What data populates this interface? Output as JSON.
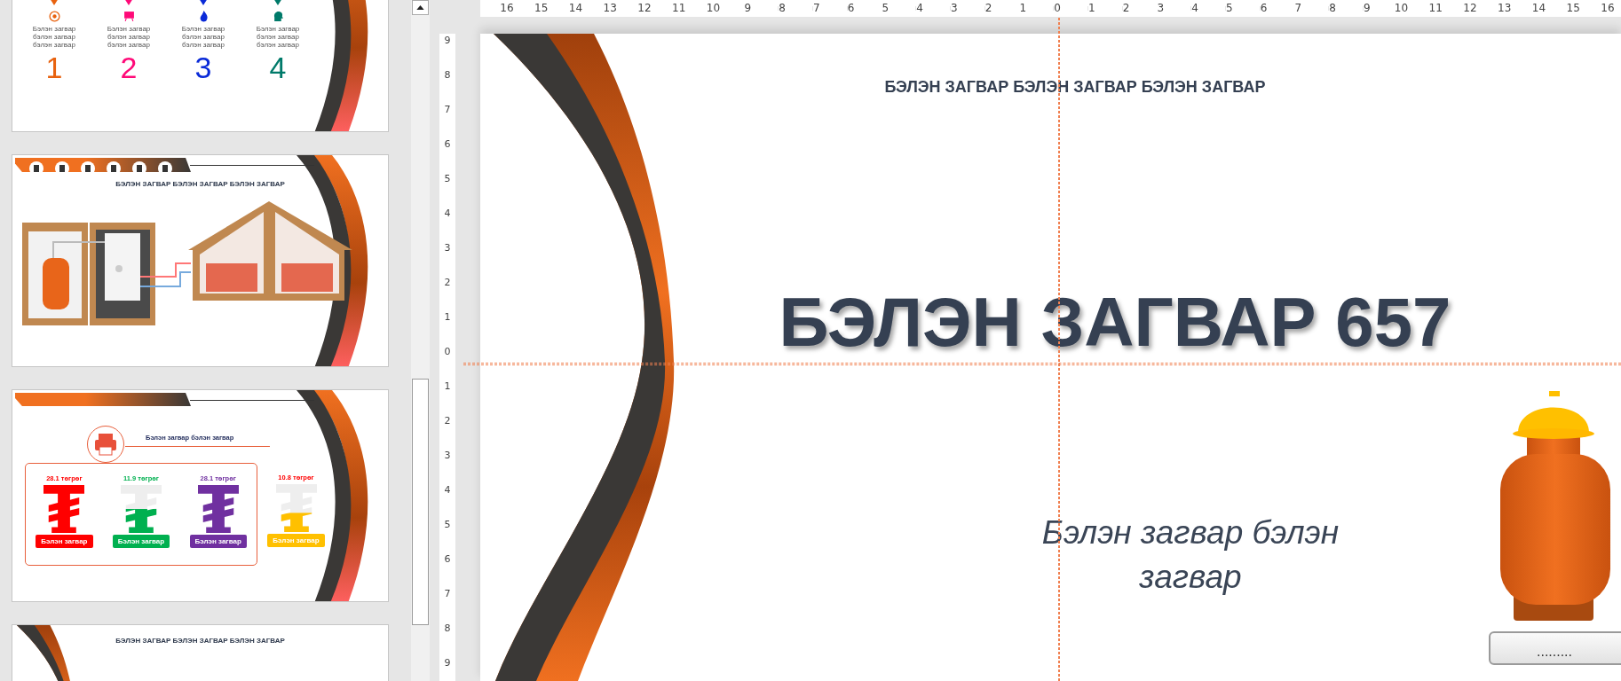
{
  "thumbnails": [
    {
      "kind": "steps",
      "steps": [
        {
          "lines": [
            "Бэлэн загвар",
            "бэлэн загвар",
            "бэлэн загвар"
          ],
          "number": "1",
          "color": "#e8620f"
        },
        {
          "lines": [
            "Бэлэн загвар",
            "бэлэн загвар",
            "бэлэн загвар"
          ],
          "number": "2",
          "color": "#ff0a78"
        },
        {
          "lines": [
            "Бэлэн загвар",
            "бэлэн загвар",
            "бэлэн загвар"
          ],
          "number": "3",
          "color": "#0a2ad8"
        },
        {
          "lines": [
            "Бэлэн загвар",
            "бэлэн загвар",
            "бэлэн загвар"
          ],
          "number": "4",
          "color": "#007a6a"
        }
      ]
    },
    {
      "kind": "diagram",
      "heading": "БЭЛЭН ЗАГВАР БЭЛЭН ЗАГВАР БЭЛЭН ЗАГВАР"
    },
    {
      "kind": "prices",
      "title": "Бэлэн загвар бэлэн загвар",
      "items": [
        {
          "value": {
            "text": "28.1 төгрөг",
            "color": "#ff0000"
          },
          "label": "Бэлэн загвар",
          "color": "#ff0000",
          "level": 1
        },
        {
          "value": {
            "text": "11.9 төгрөг",
            "color": "#00b050"
          },
          "label": "Бэлэн загвар",
          "color": "#00b050",
          "level": 0.5
        },
        {
          "value": {
            "text": "28.1 төгрөг",
            "color": "#7030a0"
          },
          "label": "Бэлэн загвар",
          "color": "#7030a0",
          "level": 1
        }
      ],
      "extra_items": [
        {
          "value": {
            "text": "10.8 төгрөг",
            "color": "#ff0000"
          },
          "label": "Бэлэн загвар",
          "color": "#ffc000",
          "level": 0.4
        }
      ]
    },
    {
      "kind": "title",
      "heading": "БЭЛЭН ЗАГВАР БЭЛЭН ЗАГВАР БЭЛЭН ЗАГВАР"
    }
  ],
  "ruler_horizontal": [
    "16",
    "15",
    "14",
    "13",
    "12",
    "11",
    "10",
    "9",
    "8",
    "7",
    "6",
    "5",
    "4",
    "3",
    "2",
    "1",
    "0",
    "1",
    "2",
    "3",
    "4",
    "5",
    "6",
    "7",
    "8",
    "9",
    "10",
    "11",
    "12",
    "13",
    "14",
    "15",
    "16"
  ],
  "ruler_vertical": [
    "9",
    "8",
    "7",
    "6",
    "5",
    "4",
    "3",
    "2",
    "1",
    "0",
    "1",
    "2",
    "3",
    "4",
    "5",
    "6",
    "7",
    "8",
    "9"
  ],
  "slide": {
    "heading": "БЭЛЭН ЗАГВАР БЭЛЭН ЗАГВАР БЭЛЭН ЗАГВАР",
    "title": "БЭЛЭН ЗАГВАР 657",
    "subtitle": "Бэлэн загвар бэлэн загвар",
    "badge": "........."
  }
}
